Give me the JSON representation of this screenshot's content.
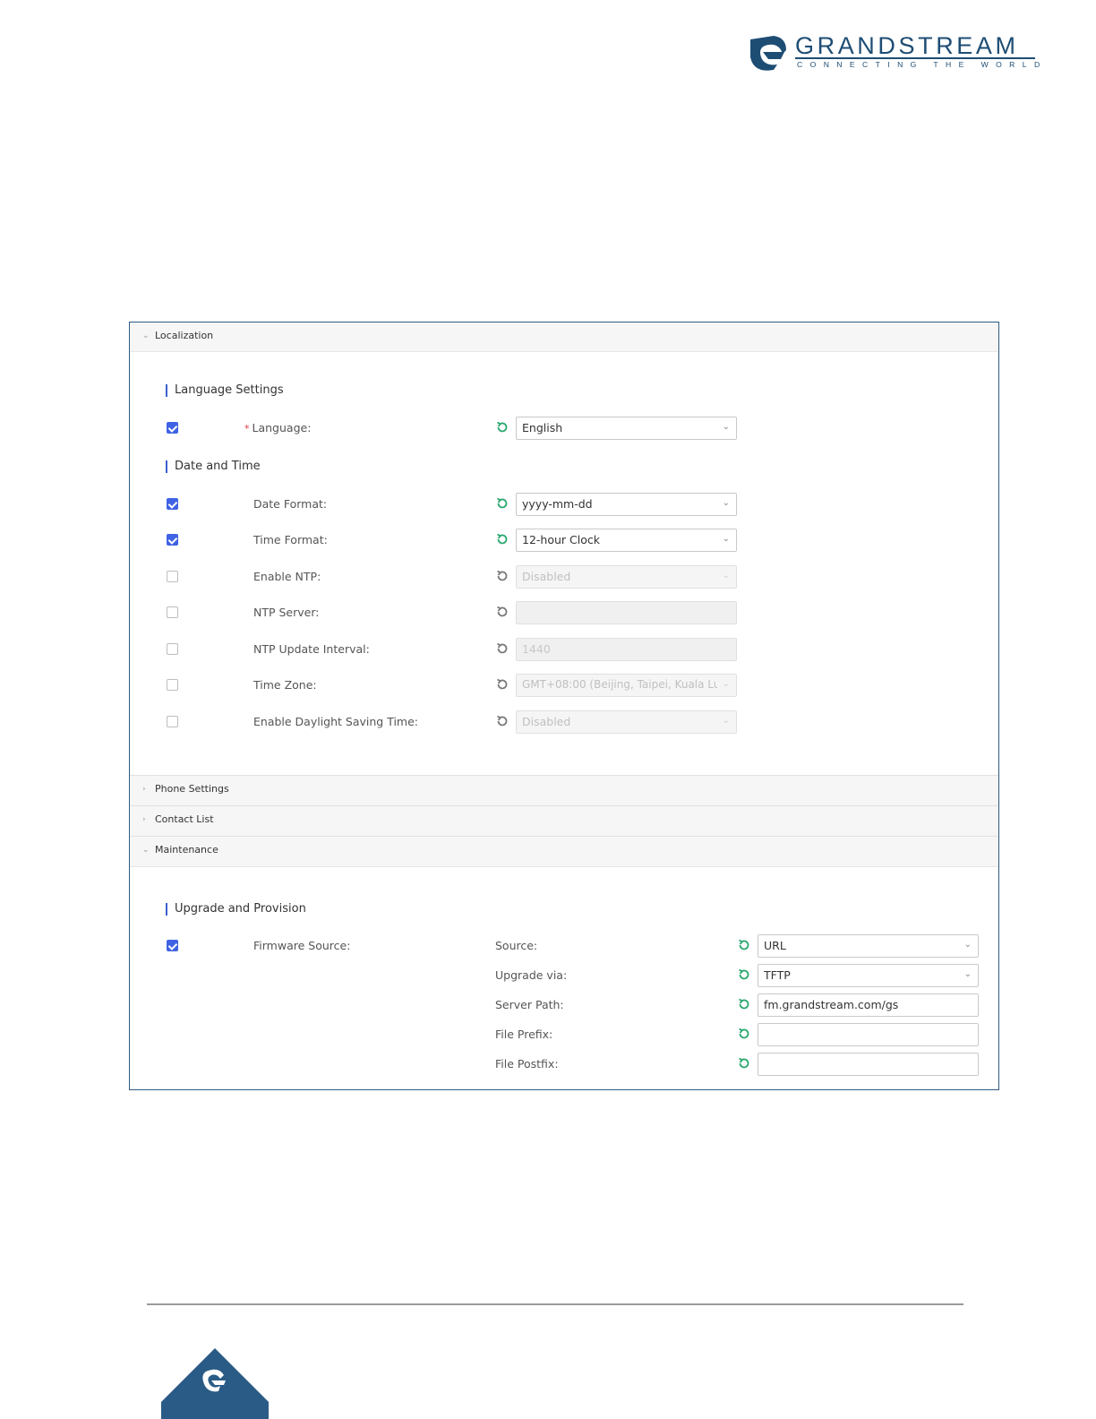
{
  "brand": {
    "name": "GRANDSTREAM",
    "tagline": "CONNECTING THE WORLD",
    "color": "#1e4d74"
  },
  "colors": {
    "accent": "#3f63e3",
    "reset_active": "#2aa86f",
    "reset_inactive": "#7a7a7a",
    "required": "#e4393c"
  },
  "sections": {
    "localization": "Localization",
    "phone_settings": "Phone Settings",
    "contact_list": "Contact List",
    "maintenance": "Maintenance"
  },
  "localization": {
    "language_group": "Language Settings",
    "date_time_group": "Date and Time",
    "rows": {
      "language": {
        "label": "Language:",
        "value": "English",
        "checked": true
      },
      "date_format": {
        "label": "Date Format:",
        "value": "yyyy-mm-dd",
        "checked": true
      },
      "time_format": {
        "label": "Time Format:",
        "value": "12-hour Clock",
        "checked": true
      },
      "enable_ntp": {
        "label": "Enable NTP:",
        "value": "Disabled",
        "checked": false
      },
      "ntp_server": {
        "label": "NTP Server:",
        "value": "",
        "checked": false
      },
      "ntp_interval": {
        "label": "NTP Update Interval:",
        "value": "1440",
        "checked": false
      },
      "time_zone": {
        "label": "Time Zone:",
        "value": "GMT+08:00 (Beijing, Taipei, Kuala Lu...",
        "checked": false
      },
      "dst": {
        "label": "Enable Daylight Saving Time:",
        "value": "Disabled",
        "checked": false
      }
    }
  },
  "maintenance": {
    "group": "Upgrade and Provision",
    "firmware_source_label": "Firmware Source:",
    "firmware_checked": true,
    "fields": {
      "source": {
        "label": "Source:",
        "value": "URL"
      },
      "upgrade_via": {
        "label": "Upgrade via:",
        "value": "TFTP"
      },
      "server_path": {
        "label": "Server Path:",
        "value": "fm.grandstream.com/gs"
      },
      "file_prefix": {
        "label": "File Prefix:",
        "value": ""
      },
      "file_postfix": {
        "label": "File Postfix:",
        "value": ""
      }
    }
  }
}
